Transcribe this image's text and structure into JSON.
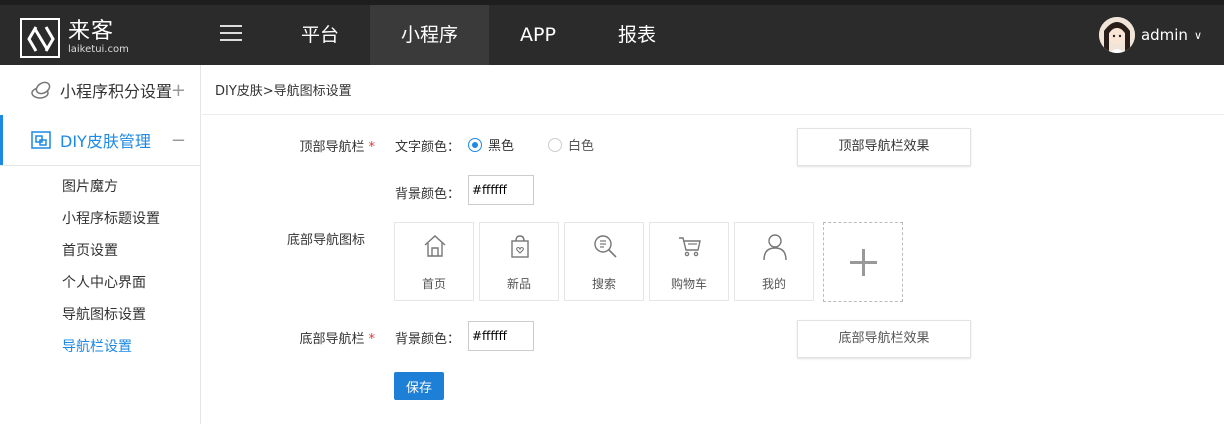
{
  "header": {
    "logo_cn": "来客",
    "logo_en": "laiketui.com",
    "nav": [
      "平台",
      "小程序",
      "APP",
      "报表"
    ],
    "active_nav": 1,
    "username": "admin",
    "caret": "∨"
  },
  "sidebar": {
    "groups": [
      {
        "label": "小程序积分设置",
        "sign": "+",
        "icon": "coins-icon"
      },
      {
        "label": "DIY皮肤管理",
        "sign": "−",
        "icon": "skin-icon"
      }
    ],
    "sub_items": [
      "图片魔方",
      "小程序标题设置",
      "首页设置",
      "个人中心界面",
      "导航图标设置",
      "导航栏设置"
    ],
    "active_sub": 5
  },
  "breadcrumb": "DIY皮肤>导航图标设置",
  "form": {
    "top_nav": {
      "label": "顶部导航栏",
      "required_mark": "*",
      "text_color_label": "文字颜色：",
      "options": [
        "黑色",
        "白色"
      ],
      "selected": "黑色",
      "bg_label": "背景颜色：",
      "bg_value": "#ffffff",
      "effect_button": "顶部导航栏效果"
    },
    "bottom_icons": {
      "label": "底部导航图标",
      "items": [
        {
          "label": "首页",
          "icon": "home-icon"
        },
        {
          "label": "新品",
          "icon": "bag-icon"
        },
        {
          "label": "搜索",
          "icon": "search-icon"
        },
        {
          "label": "购物车",
          "icon": "cart-icon"
        },
        {
          "label": "我的",
          "icon": "user-icon"
        }
      ],
      "add_icon": "plus-icon"
    },
    "bottom_nav": {
      "label": "底部导航栏",
      "required_mark": "*",
      "bg_label": "背景颜色：",
      "bg_value": "#ffffff",
      "effect_button": "底部导航栏效果"
    },
    "save_button": "保存"
  },
  "colors": {
    "topbar": "#2b2b2b",
    "accent": "#1e88e5",
    "save": "#1e7fd6",
    "required": "#e53935"
  }
}
